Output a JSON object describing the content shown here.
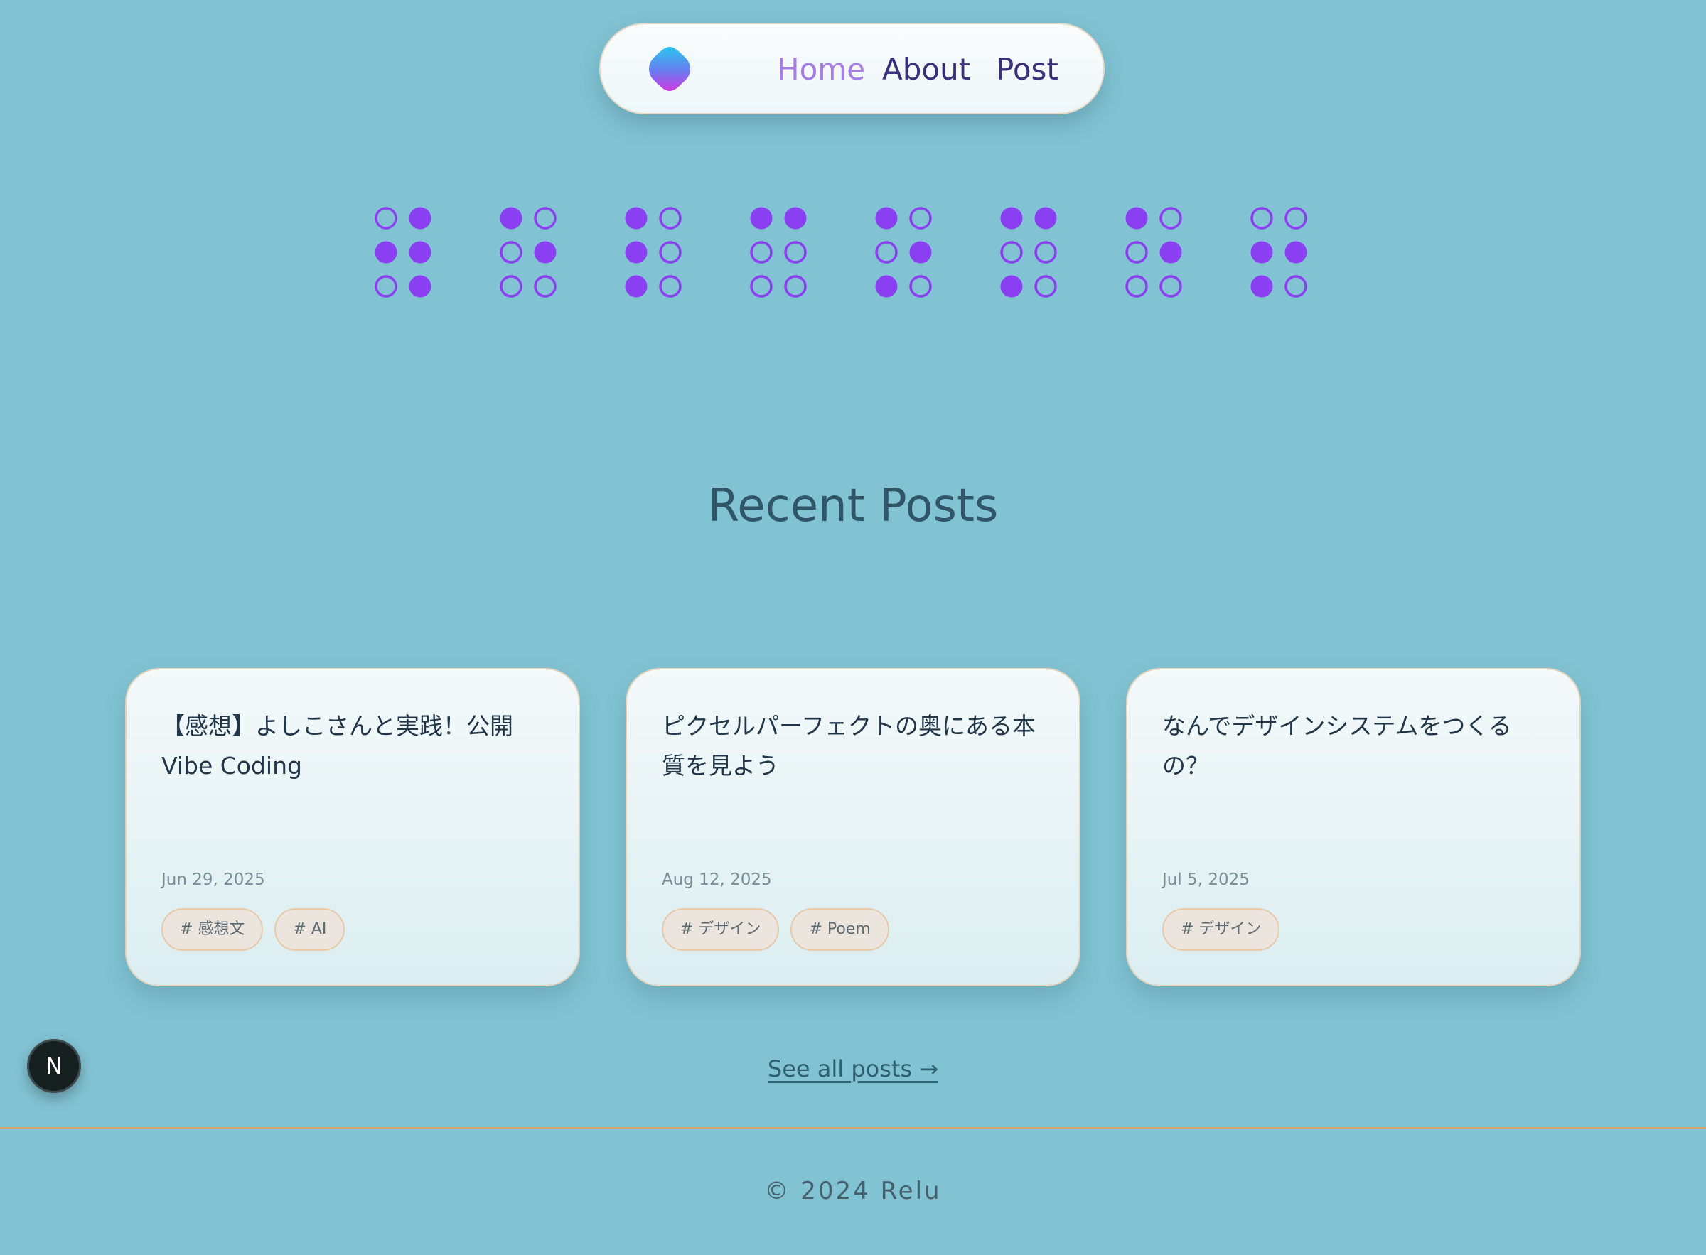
{
  "nav": {
    "logo_icon": "gradient-diamond-logo-icon",
    "links": [
      "Home",
      "About",
      "Post"
    ],
    "active": "Home"
  },
  "braille": {
    "dot_color": "#8a3ff0",
    "cells": [
      [
        [
          0,
          1
        ],
        [
          1,
          1
        ],
        [
          0,
          1
        ]
      ],
      [
        [
          1,
          0
        ],
        [
          0,
          1
        ],
        [
          0,
          0
        ]
      ],
      [
        [
          1,
          0
        ],
        [
          1,
          0
        ],
        [
          1,
          0
        ]
      ],
      [
        [
          1,
          1
        ],
        [
          0,
          0
        ],
        [
          0,
          0
        ]
      ],
      [
        [
          1,
          0
        ],
        [
          0,
          1
        ],
        [
          1,
          0
        ]
      ],
      [
        [
          1,
          1
        ],
        [
          0,
          0
        ],
        [
          1,
          0
        ]
      ],
      [
        [
          1,
          0
        ],
        [
          0,
          1
        ],
        [
          0,
          0
        ]
      ],
      [
        [
          0,
          0
        ],
        [
          1,
          1
        ],
        [
          1,
          0
        ]
      ]
    ]
  },
  "recent": {
    "title": "Recent Posts",
    "posts": [
      {
        "title": "【感想】よしこさんと実践！公開Vibe Coding",
        "date": "Jun 29, 2025",
        "tags": [
          "# 感想文",
          "# AI"
        ]
      },
      {
        "title": "ピクセルパーフェクトの奥にある本質を見よう",
        "date": "Aug 12, 2025",
        "tags": [
          "# デザイン",
          "# Poem"
        ]
      },
      {
        "title": "なんでデザインシステムをつくるの？",
        "date": "Jul 5, 2025",
        "tags": [
          "# デザイン"
        ]
      }
    ],
    "see_all": "See all posts →"
  },
  "badge": {
    "label": "N"
  },
  "footer": {
    "copyright": "© 2024 Relu"
  },
  "colors": {
    "background": "#82c3d3",
    "accent": "#a77de6",
    "nav_text": "#3a2f78",
    "footer_rule": "#d9a06a"
  }
}
